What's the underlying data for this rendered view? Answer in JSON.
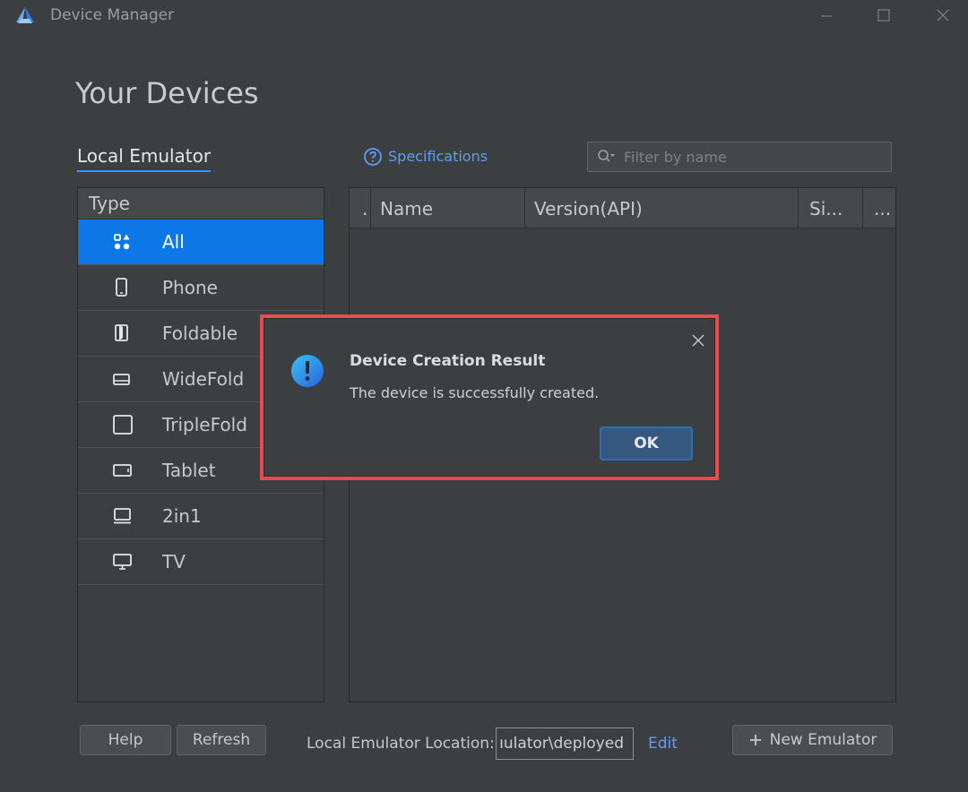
{
  "window": {
    "title": "Device Manager",
    "accent": "#0e77e8"
  },
  "page": {
    "title": "Your Devices"
  },
  "tabs": {
    "local_emulator": "Local Emulator"
  },
  "specifications": {
    "label": "Specifications",
    "icon": "help-circle-icon"
  },
  "filter": {
    "placeholder": "Filter by name",
    "value": ""
  },
  "type_panel": {
    "header": "Type",
    "items": [
      {
        "label": "All",
        "icon": "grid-icon",
        "selected": true
      },
      {
        "label": "Phone",
        "icon": "phone-icon"
      },
      {
        "label": "Foldable",
        "icon": "foldable-icon"
      },
      {
        "label": "WideFold",
        "icon": "widefold-icon"
      },
      {
        "label": "TripleFold",
        "icon": "triplefold-icon"
      },
      {
        "label": "Tablet",
        "icon": "tablet-icon"
      },
      {
        "label": "2in1",
        "icon": "laptop-icon"
      },
      {
        "label": "TV",
        "icon": "tv-icon"
      }
    ]
  },
  "device_table": {
    "columns": [
      ".",
      "Name",
      "Version(API)",
      "Si...",
      "..."
    ],
    "rows": []
  },
  "dialog": {
    "title": "Device Creation Result",
    "message": "The device is successfully created.",
    "ok_label": "OK",
    "highlight_color": "#e84b4b"
  },
  "bottom_bar": {
    "help_label": "Help",
    "refresh_label": "Refresh",
    "location_label": "Local Emulator Location:",
    "location_value": "ıulator\\deployed",
    "edit_label": "Edit",
    "new_emulator_label": "New Emulator"
  }
}
